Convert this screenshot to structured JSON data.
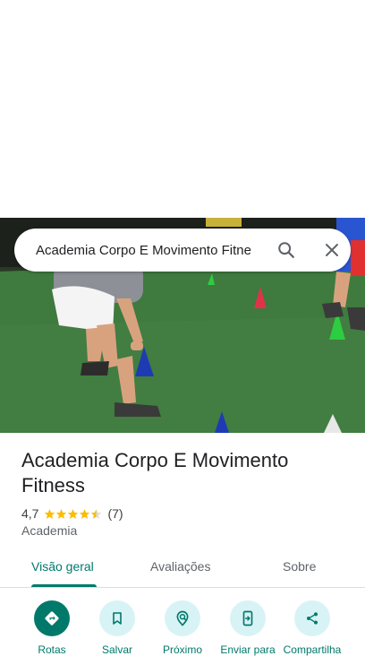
{
  "search": {
    "query": "Academia Corpo E Movimento Fitne"
  },
  "place": {
    "name": "Academia Corpo E Movimento Fitness",
    "rating": "4,7",
    "review_count": "(7)",
    "stars_filled": 4.5,
    "category": "Academia"
  },
  "tabs": [
    {
      "label": "Visão geral",
      "active": true
    },
    {
      "label": "Avaliações",
      "active": false
    },
    {
      "label": "Sobre",
      "active": false
    }
  ],
  "actions": [
    {
      "label": "Rotas",
      "icon": "directions-icon"
    },
    {
      "label": "Salvar",
      "icon": "bookmark-icon"
    },
    {
      "label": "Próximo",
      "icon": "nearby-icon"
    },
    {
      "label": "Enviar para",
      "icon": "send-to-phone-icon"
    },
    {
      "label": "Compartilha",
      "icon": "share-icon"
    }
  ],
  "colors": {
    "accent": "#00796b",
    "action_bg": "#d8f3f5",
    "star": "#fbbc04"
  }
}
